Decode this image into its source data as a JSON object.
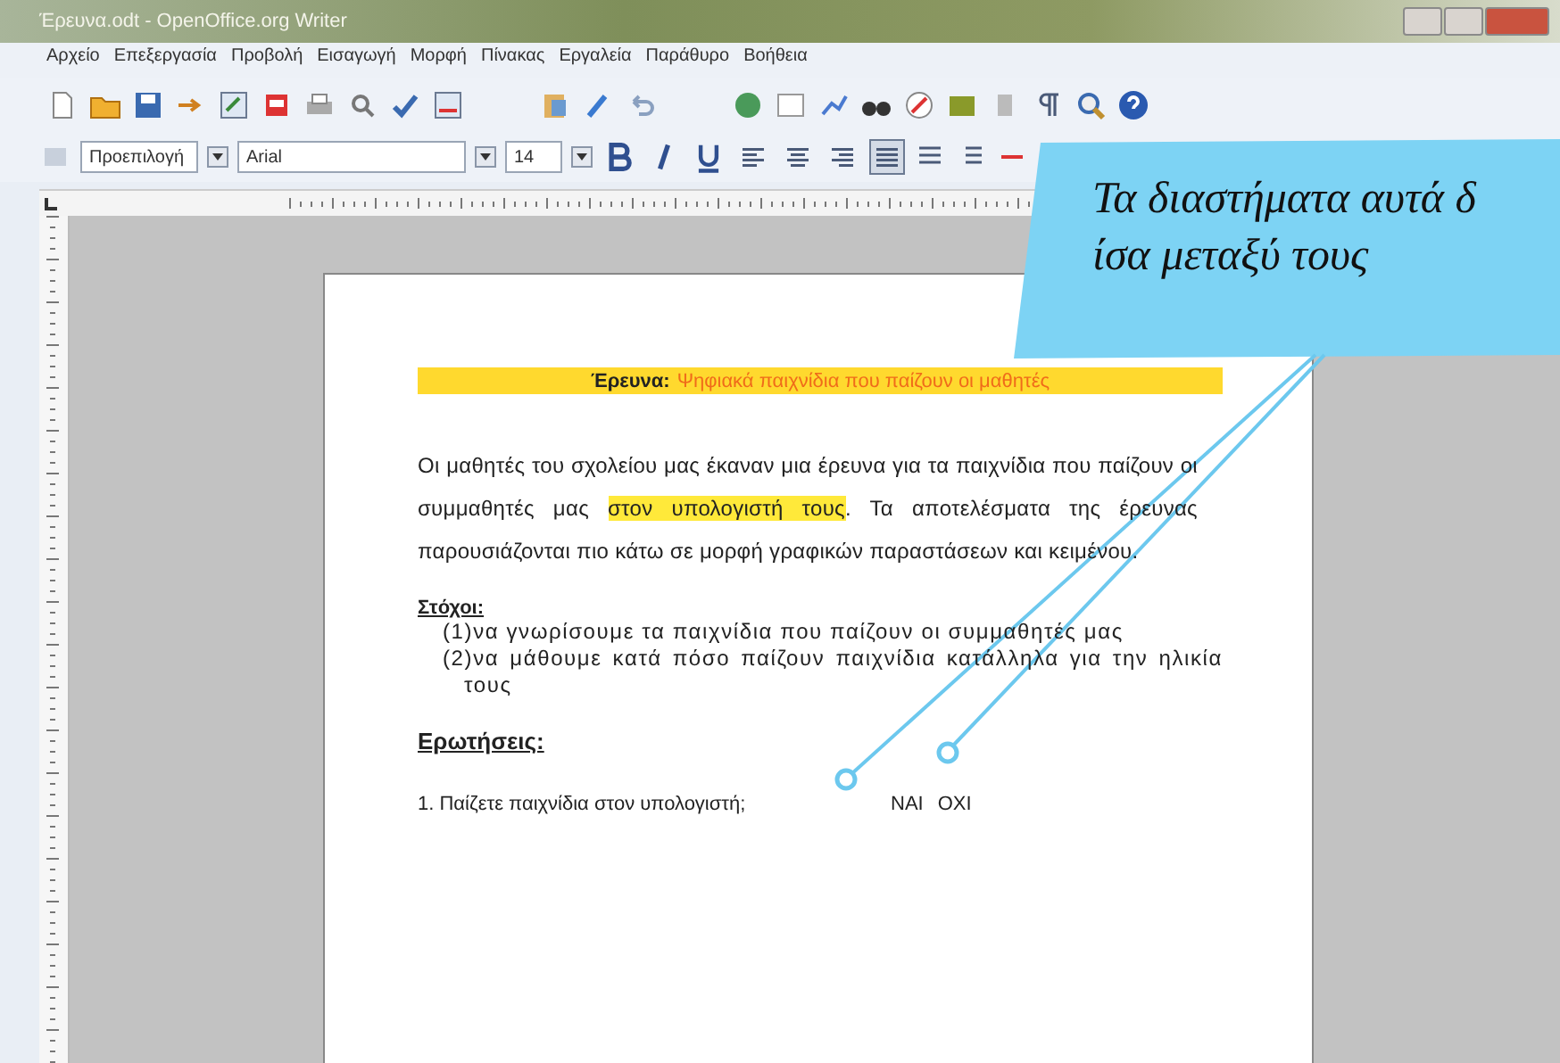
{
  "window": {
    "title": "Έρευνα.odt - OpenOffice.org Writer"
  },
  "menu": [
    "Αρχείο",
    "Επεξεργασία",
    "Προβολή",
    "Εισαγωγή",
    "Μορφή",
    "Πίνακας",
    "Εργαλεία",
    "Παράθυρο",
    "Βοήθεια"
  ],
  "format_bar": {
    "style": "Προεπιλογή",
    "font": "Arial",
    "size": "14",
    "alignment_buttons": [
      {
        "selected": false
      },
      {
        "selected": false
      },
      {
        "selected": false
      },
      {
        "selected": true
      }
    ]
  },
  "document": {
    "heading_label": "Έρευνα:",
    "heading_text": "Ψηφιακά παιχνίδια που παίζουν οι μαθητές",
    "paragraph": {
      "before": "Οι μαθητές του σχολείου μας έκαναν μια έρευνα για τα παιχνίδια που παίζουν οι συμμαθητές μας ",
      "highlighted": "στον υπολογιστή τους",
      "after": ". Τα αποτελέσματα της έρευνας παρουσιάζονται πιο κάτω σε μορφή γραφικών παραστάσεων και κειμένου."
    },
    "goals_title": "Στόχοι:",
    "goals": [
      "(1)να γνωρίσουμε τα παιχνίδια που παίζουν οι συμμαθητές μας",
      "(2)να μάθουμε κατά πόσο παίζουν παιχνίδια κατάλληλα για την ηλικία τους"
    ],
    "questions_title": "Ερωτήσεις:",
    "question": "1. Παίζετε παιχνίδια στον υπολογιστή;",
    "answers": [
      "ΝΑΙ",
      "ΟΧΙ"
    ]
  },
  "callout": {
    "lines": [
      "Τα διαστήματα αυτά δ",
      "ίσα μεταξύ τους"
    ]
  }
}
